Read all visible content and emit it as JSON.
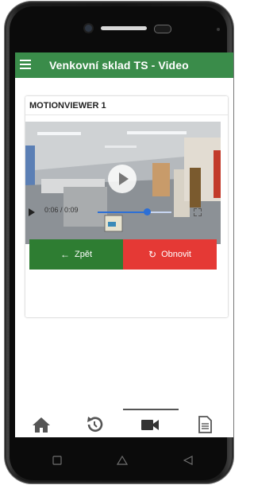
{
  "app": {
    "title": "Venkovní sklad TS - Video"
  },
  "card": {
    "title": "MOTIONVIEWER 1"
  },
  "player": {
    "time": "0:06 / 0:09",
    "progress": 0.67
  },
  "buttons": {
    "back": "Zpět",
    "refresh": "Obnovit"
  },
  "colors": {
    "appbar": "#3a8c4a",
    "back": "#2e7d32",
    "refresh": "#e53935",
    "accent": "#2c6fd6"
  },
  "icons": {
    "menu": "menu-icon",
    "play": "play-icon",
    "fullscreen": "fullscreen-icon",
    "back": "arrow-left-icon",
    "refresh": "refresh-icon",
    "nav": [
      "home-icon",
      "history-icon",
      "video-camera-icon",
      "document-icon"
    ]
  },
  "nav": {
    "active_index": 2
  }
}
